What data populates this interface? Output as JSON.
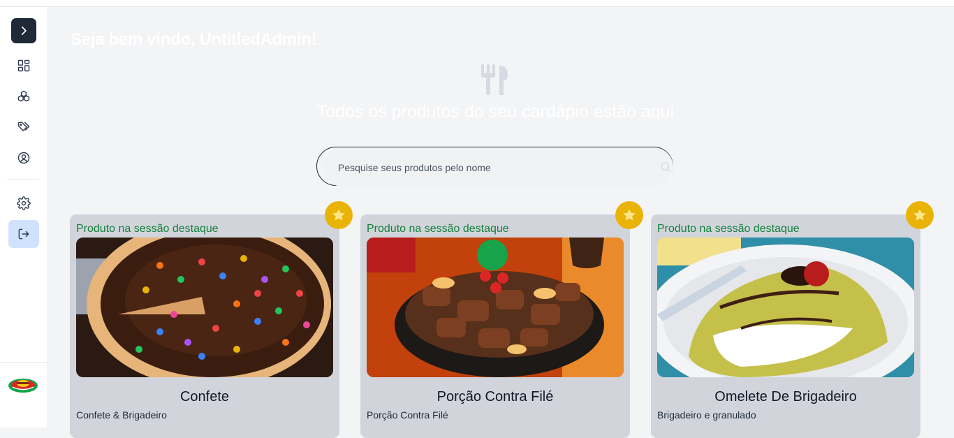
{
  "header": {
    "welcome": "Seja bem vindo, UntitledAdmin!",
    "subtitle": "Todos os produtos do seu cardápio estão aqui"
  },
  "search": {
    "placeholder": "Pesquise seus produtos pelo nome",
    "value": ""
  },
  "sidebar": {
    "items": [
      {
        "name": "toggle",
        "icon": "chevron-right-icon"
      },
      {
        "name": "dashboard",
        "icon": "dashboard-icon"
      },
      {
        "name": "categories",
        "icon": "layers-icon"
      },
      {
        "name": "tags",
        "icon": "tags-icon"
      },
      {
        "name": "profile",
        "icon": "user-circle-icon"
      },
      {
        "name": "settings",
        "icon": "gear-icon"
      },
      {
        "name": "logout",
        "icon": "logout-icon"
      }
    ]
  },
  "products": [
    {
      "featured_label": "Produto na sessão destaque",
      "name": "Confete",
      "description": "Confete & Brigadeiro",
      "image": "chocolate-pizza-with-candies"
    },
    {
      "featured_label": "Produto na sessão destaque",
      "name": "Porção Contra Filé",
      "description": "Porção Contra Filé",
      "image": "steak-portion-on-skillet"
    },
    {
      "featured_label": "Produto na sessão destaque",
      "name": "Omelete De Brigadeiro",
      "description": "Brigadeiro e granulado",
      "image": "sweet-omelette-with-chocolate"
    }
  ],
  "colors": {
    "accent_star": "#eab308",
    "featured_text": "#15803d",
    "sidebar_dark": "#1f2937",
    "logout_bg": "#cfe3ff",
    "card_bg": "#d1d5db"
  }
}
